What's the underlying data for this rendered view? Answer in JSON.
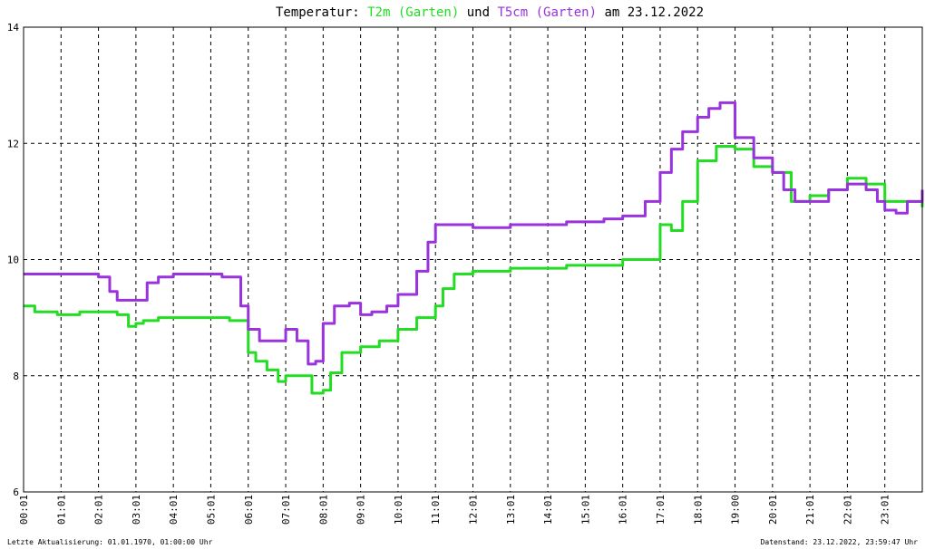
{
  "title": {
    "prefix": "Temperatur: ",
    "series1": "T2m (Garten)",
    "mid": " und ",
    "series2": "T5cm (Garten)",
    "suffix": " am 23.12.2022"
  },
  "footer": {
    "left": "Letzte Aktualisierung: 01.01.1970, 01:00:00 Uhr",
    "right": "Datenstand: 23.12.2022, 23:59:47 Uhr"
  },
  "colors": {
    "t2m": "#22dd22",
    "t5cm": "#9933dd",
    "grid": "#000000"
  },
  "chart_data": {
    "type": "line",
    "xlabels": [
      "00:01",
      "01:01",
      "02:01",
      "03:01",
      "04:01",
      "05:01",
      "06:01",
      "07:01",
      "08:01",
      "09:01",
      "10:01",
      "11:01",
      "12:01",
      "13:01",
      "14:01",
      "15:01",
      "16:01",
      "17:01",
      "18:01",
      "19:00",
      "20:01",
      "21:01",
      "22:01",
      "23:01"
    ],
    "yticks": [
      "6",
      "8",
      "10",
      "12",
      "14"
    ],
    "xlim": [
      0,
      24
    ],
    "ylim": [
      6,
      14
    ],
    "grid": true,
    "series": [
      {
        "name": "T2m (Garten)",
        "x": [
          0,
          0.3,
          0.9,
          1.2,
          1.5,
          2.0,
          2.5,
          2.8,
          3.0,
          3.2,
          3.6,
          4.0,
          4.5,
          5.0,
          5.5,
          6.0,
          6.2,
          6.5,
          6.8,
          7.0,
          7.5,
          7.7,
          8.0,
          8.2,
          8.5,
          9.0,
          9.5,
          10.0,
          10.5,
          11.0,
          11.2,
          11.5,
          12.0,
          12.5,
          13.0,
          13.5,
          14.0,
          14.5,
          15.0,
          15.5,
          16.0,
          16.5,
          17.0,
          17.3,
          17.6,
          18.0,
          18.5,
          19.0,
          19.5,
          20.0,
          20.5,
          21.0,
          21.5,
          22.0,
          22.5,
          23.0,
          23.5,
          24.0
        ],
        "y": [
          9.2,
          9.1,
          9.05,
          9.05,
          9.1,
          9.1,
          9.05,
          8.85,
          8.9,
          8.95,
          9.0,
          9.0,
          9.0,
          9.0,
          8.95,
          8.4,
          8.25,
          8.1,
          7.9,
          8.0,
          8.0,
          7.7,
          7.75,
          8.05,
          8.4,
          8.5,
          8.6,
          8.8,
          9.0,
          9.2,
          9.5,
          9.75,
          9.8,
          9.8,
          9.85,
          9.85,
          9.85,
          9.9,
          9.9,
          9.9,
          10.0,
          10.0,
          10.6,
          10.5,
          11.0,
          11.7,
          11.95,
          11.9,
          11.6,
          11.5,
          11.0,
          11.1,
          11.2,
          11.4,
          11.3,
          11.0,
          11.0,
          10.9
        ],
        "color": "#22dd22"
      },
      {
        "name": "T5cm (Garten)",
        "x": [
          0,
          0.5,
          1.0,
          1.8,
          2.0,
          2.3,
          2.5,
          3.0,
          3.3,
          3.6,
          4.0,
          4.5,
          5.0,
          5.3,
          5.8,
          6.0,
          6.3,
          6.7,
          7.0,
          7.3,
          7.6,
          7.8,
          8.0,
          8.3,
          8.7,
          9.0,
          9.3,
          9.7,
          10.0,
          10.5,
          10.8,
          11.0,
          11.5,
          12.0,
          12.5,
          13.0,
          13.5,
          14.0,
          14.5,
          15.0,
          15.5,
          16.0,
          16.3,
          16.6,
          17.0,
          17.3,
          17.6,
          18.0,
          18.3,
          18.6,
          19.0,
          19.5,
          20.0,
          20.3,
          20.6,
          21.0,
          21.5,
          22.0,
          22.5,
          22.8,
          23.0,
          23.3,
          23.6,
          24.0
        ],
        "y": [
          9.75,
          9.75,
          9.75,
          9.75,
          9.7,
          9.45,
          9.3,
          9.3,
          9.6,
          9.7,
          9.75,
          9.75,
          9.75,
          9.7,
          9.2,
          8.8,
          8.6,
          8.6,
          8.8,
          8.6,
          8.2,
          8.25,
          8.9,
          9.2,
          9.25,
          9.05,
          9.1,
          9.2,
          9.4,
          9.8,
          10.3,
          10.6,
          10.6,
          10.55,
          10.55,
          10.6,
          10.6,
          10.6,
          10.65,
          10.65,
          10.7,
          10.75,
          10.75,
          11.0,
          11.5,
          11.9,
          12.2,
          12.45,
          12.6,
          12.7,
          12.1,
          11.75,
          11.5,
          11.2,
          11.0,
          11.0,
          11.2,
          11.3,
          11.2,
          11.0,
          10.85,
          10.8,
          11.0,
          11.2
        ],
        "color": "#9933dd"
      }
    ]
  }
}
